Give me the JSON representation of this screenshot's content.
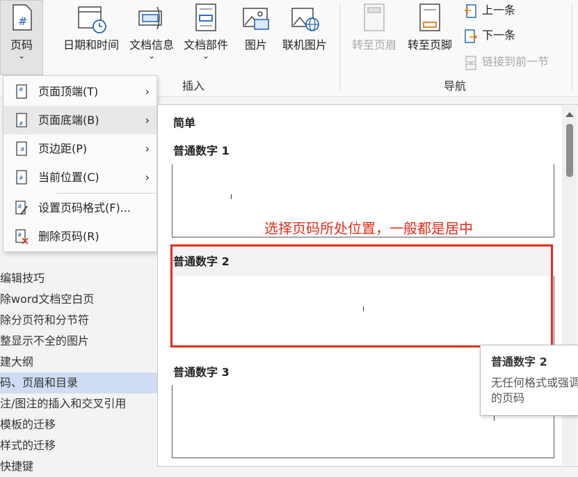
{
  "ribbon": {
    "page_number": {
      "label": "页码",
      "chevron": "⌄",
      "icon": "page-number-icon",
      "glyph": "#"
    },
    "insert_buttons": [
      {
        "label": "日期和时间",
        "icon": "calendar-clock-icon"
      },
      {
        "label": "文档信息",
        "icon": "document-info-icon",
        "chevron": "⌄"
      },
      {
        "label": "文档部件",
        "icon": "quick-parts-icon",
        "chevron": "⌄"
      },
      {
        "label": "图片",
        "icon": "picture-icon"
      },
      {
        "label": "联机图片",
        "icon": "online-picture-icon"
      }
    ],
    "insert_group_label": "插入",
    "nav_buttons": [
      {
        "label": "转至页眉",
        "icon": "goto-header-icon",
        "disabled": true
      },
      {
        "label": "转至页脚",
        "icon": "goto-footer-icon",
        "disabled": false
      }
    ],
    "nav_small": [
      {
        "label": "上一条",
        "icon": "previous-icon",
        "disabled": false
      },
      {
        "label": "下一条",
        "icon": "next-icon",
        "disabled": false
      },
      {
        "label": "链接到前一节",
        "icon": "link-previous-icon",
        "disabled": true
      }
    ],
    "nav_group_label": "导航"
  },
  "menu": {
    "items": [
      {
        "label": "页面顶端(T)",
        "has_submenu": true,
        "icon": "page-top-icon"
      },
      {
        "label": "页面底端(B)",
        "has_submenu": true,
        "icon": "page-bottom-icon",
        "highlighted": true
      },
      {
        "label": "页边距(P)",
        "has_submenu": true,
        "icon": "page-margin-icon"
      },
      {
        "label": "当前位置(C)",
        "has_submenu": true,
        "icon": "current-position-icon"
      },
      {
        "label": "设置页码格式(F)...",
        "has_submenu": false,
        "icon": "format-page-number-icon"
      },
      {
        "label": "删除页码(R)",
        "has_submenu": false,
        "icon": "remove-page-number-icon"
      }
    ],
    "submenu_arrow": "›"
  },
  "left_pane": {
    "items": [
      {
        "label": "编辑技巧",
        "selected": false
      },
      {
        "label": "除word文档空白页",
        "selected": false
      },
      {
        "label": "除分页符和分节符",
        "selected": false
      },
      {
        "label": "整显示不全的图片",
        "selected": false
      },
      {
        "label": "建大纲",
        "selected": false
      },
      {
        "label": "码、页眉和目录",
        "selected": true
      },
      {
        "label": "注/图注的插入和交叉引用",
        "selected": false
      },
      {
        "label": "模板的迁移",
        "selected": false
      },
      {
        "label": "样式的迁移",
        "selected": false
      },
      {
        "label": "快捷键",
        "selected": false
      }
    ]
  },
  "gallery": {
    "section_title": "简单",
    "options": [
      {
        "label": "普通数字 1"
      },
      {
        "label": "普通数字 2"
      },
      {
        "label": "普通数字 3"
      }
    ]
  },
  "annotation": "选择页码所处位置，一般都是居中",
  "tooltip": {
    "title": "普通数字 2",
    "description_line1": "无任何格式或强调",
    "description_line2": "的页码"
  },
  "colors": {
    "accent_red": "#e52b1a",
    "hover": "#e8e8e8",
    "selected": "#cfdcf3"
  }
}
